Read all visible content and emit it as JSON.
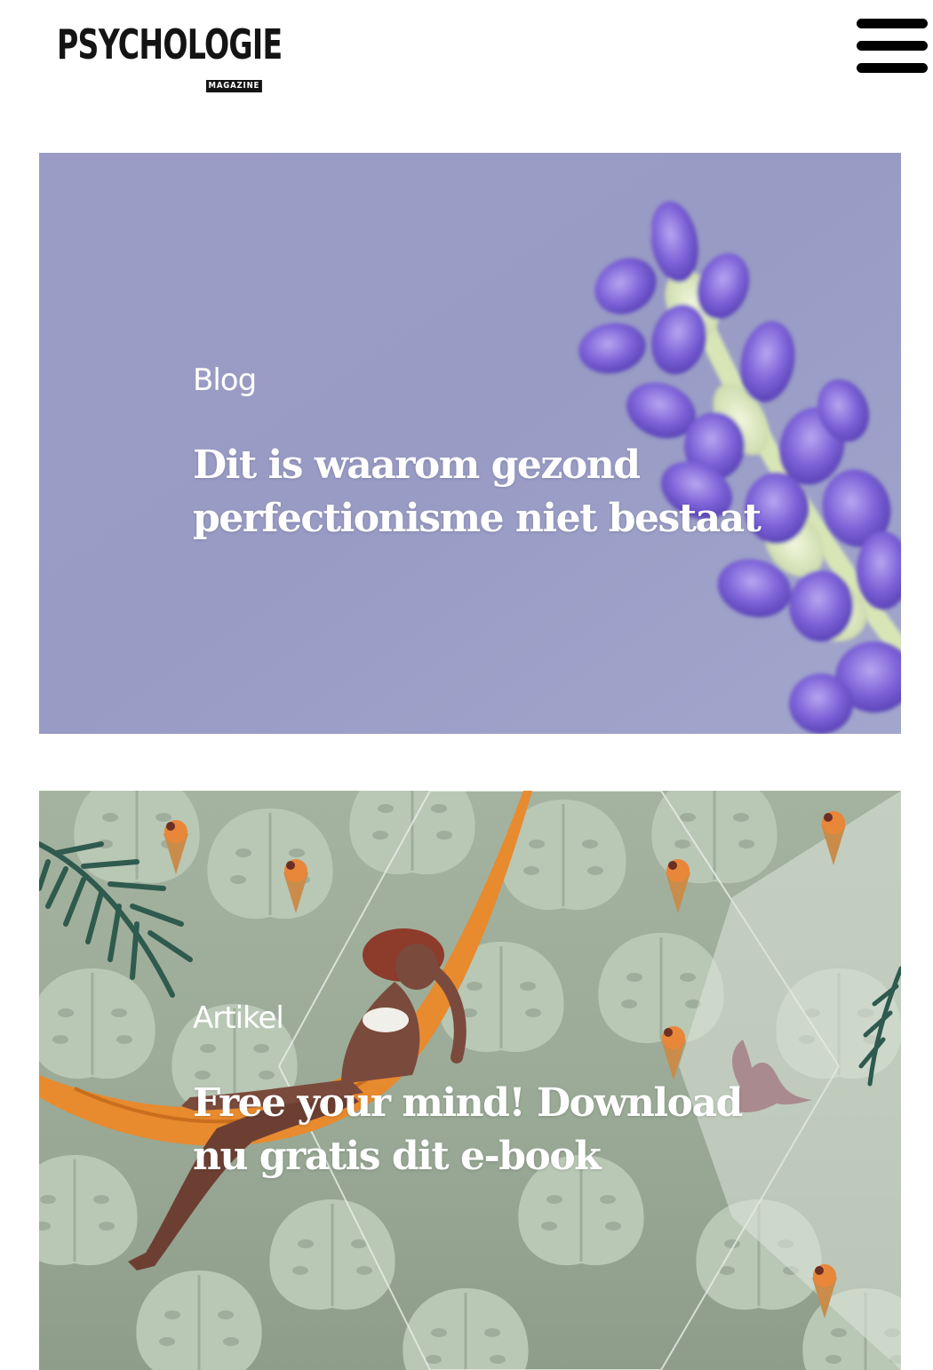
{
  "header": {
    "logo": {
      "word": "PSYCHOLOGIE",
      "sub": "MAGAZINE"
    },
    "menu_icon": "hamburger-menu-icon"
  },
  "cards": [
    {
      "category": "Blog",
      "title": "Dit is waarom gezond perfectionisme niet bestaat",
      "image": "lavender-flower-image",
      "background_color": "#9c9fc8"
    },
    {
      "category": "Artikel",
      "title": "Free your mind! Download nu gratis dit e-book",
      "image": "woman-in-hammock-illustration",
      "background_color": "#9fae9c"
    }
  ],
  "colors": {
    "text_on_image": "#ffffff",
    "logo": "#141414",
    "lavender": "#7a63d6",
    "hammock": "#e88a2e"
  }
}
